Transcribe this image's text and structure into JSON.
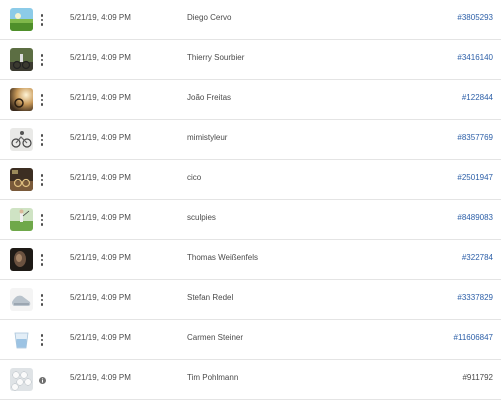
{
  "rows": [
    {
      "date": "5/21/19, 4:09 PM",
      "name": "Diego Cervo",
      "id": "#3805293",
      "id_link": true,
      "thumb": "golf-field-icon"
    },
    {
      "date": "5/21/19, 4:09 PM",
      "name": "Thierry Sourbier",
      "id": "#3416140",
      "id_link": true,
      "thumb": "cyclist-icon"
    },
    {
      "date": "5/21/19, 4:09 PM",
      "name": "João Freitas",
      "id": "#122844",
      "id_link": true,
      "thumb": "sunset-rider-icon"
    },
    {
      "date": "5/21/19, 4:09 PM",
      "name": "mimistyleur",
      "id": "#8357769",
      "id_link": true,
      "thumb": "bmx-icon"
    },
    {
      "date": "5/21/19, 4:09 PM",
      "name": "cico",
      "id": "#2501947",
      "id_link": true,
      "thumb": "bike-trail-icon"
    },
    {
      "date": "5/21/19, 4:09 PM",
      "name": "sculpies",
      "id": "#8489083",
      "id_link": true,
      "thumb": "golfer-icon"
    },
    {
      "date": "5/21/19, 4:09 PM",
      "name": "Thomas Weißenfels",
      "id": "#322784",
      "id_link": true,
      "thumb": "dark-portrait-icon"
    },
    {
      "date": "5/21/19, 4:09 PM",
      "name": "Stefan Redel",
      "id": "#3337829",
      "id_link": true,
      "thumb": "sneaker-icon"
    },
    {
      "date": "5/21/19, 4:09 PM",
      "name": "Carmen Steiner",
      "id": "#11606847",
      "id_link": true,
      "thumb": "water-glass-icon"
    },
    {
      "date": "5/21/19, 4:09 PM",
      "name": "Tim Pohlmann",
      "id": "#911792",
      "id_link": false,
      "thumb": "golf-balls-icon"
    }
  ]
}
